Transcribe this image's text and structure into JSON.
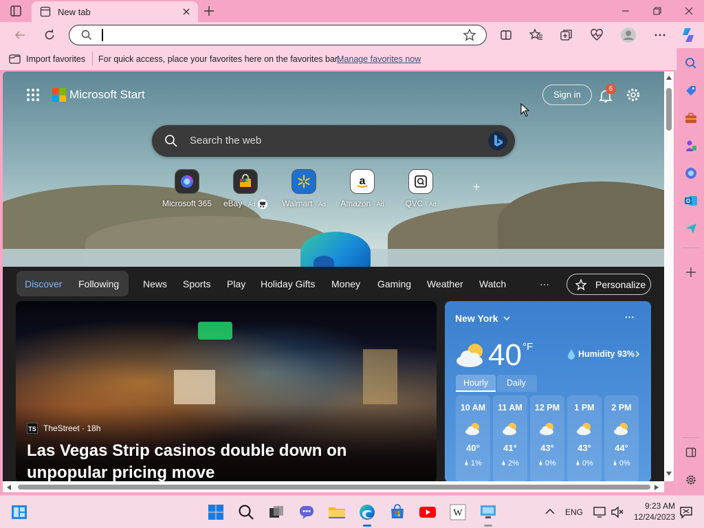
{
  "browser": {
    "tab_title": "New tab",
    "address_value": "",
    "favorites_bar": {
      "import_label": "Import favorites",
      "hint": "For quick access, place your favorites here on the favorites bar.",
      "manage_link": "Manage favorites now"
    }
  },
  "start_page": {
    "brand": "Microsoft Start",
    "sign_in": "Sign in",
    "notifications_count": "6",
    "search_placeholder": "Search the web",
    "quick_links": [
      {
        "label": "Microsoft 365",
        "ad": ""
      },
      {
        "label": "eBay",
        "ad": "· Ad"
      },
      {
        "label": "Walmart",
        "ad": "· Ad"
      },
      {
        "label": "Amazon",
        "ad": "· Ad"
      },
      {
        "label": "QVC",
        "ad": "· Ad"
      }
    ],
    "add_link": "+",
    "nav": {
      "discover": "Discover",
      "following": "Following",
      "items": [
        "News",
        "Sports",
        "Play",
        "Holiday Gifts",
        "Money",
        "Gaming",
        "Weather",
        "Watch"
      ],
      "more": "···",
      "personalize": "Personalize"
    },
    "hero": {
      "source_logo": "TS",
      "source": "TheStreet · 18h",
      "headline": "Las Vegas Strip casinos double down on unpopular pricing move"
    },
    "weather": {
      "location": "New York",
      "temperature": "40",
      "unit": "°F",
      "humidity": "Humidity 93%",
      "tab_hourly": "Hourly",
      "tab_daily": "Daily",
      "hourly": [
        {
          "time": "10 AM",
          "temp": "40°",
          "precip": "1%"
        },
        {
          "time": "11 AM",
          "temp": "41°",
          "precip": "2%"
        },
        {
          "time": "12 PM",
          "temp": "43°",
          "precip": "0%"
        },
        {
          "time": "1 PM",
          "temp": "43°",
          "precip": "0%"
        },
        {
          "time": "2 PM",
          "temp": "44°",
          "precip": "0%"
        }
      ]
    }
  },
  "taskbar": {
    "language": "ENG",
    "time": "9:23 AM",
    "date": "12/24/2023"
  },
  "icons": {
    "brand_colors": [
      "#f25022",
      "#7fba00",
      "#00a4ef",
      "#ffb900"
    ],
    "accent": "#2f7ae5"
  }
}
